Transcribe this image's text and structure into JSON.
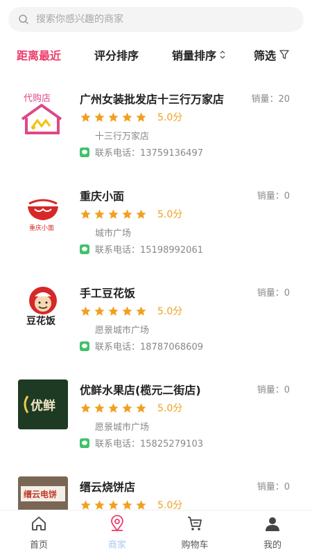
{
  "search": {
    "placeholder": "搜索你感兴趣的商家"
  },
  "sortbar": {
    "distance": "距离最近",
    "rating": "评分排序",
    "sales": "销量排序",
    "filter": "筛选"
  },
  "colors": {
    "accent": "#ee3b6a",
    "star": "#f0a020",
    "wechat": "#41c16b",
    "tab_active": "#a6c8f0"
  },
  "shops": [
    {
      "name": "广州女装批发店十三行万家店",
      "sales": "销量：20",
      "score": "5.0分",
      "stars": 5,
      "address": "十三行万家店",
      "phone": "联系电话：13759136497",
      "logo_icon": "dai-gou-dian-logo",
      "logo_text": "代购店"
    },
    {
      "name": "重庆小面",
      "sales": "销量：0",
      "score": "5.0分",
      "stars": 5,
      "address": "城市广场",
      "phone": "联系电话：15198992061",
      "logo_icon": "noodle-bowl-logo",
      "logo_text": "重庆小面"
    },
    {
      "name": "手工豆花饭",
      "sales": "销量：0",
      "score": "5.0分",
      "stars": 5,
      "address": "愿景城市广场",
      "phone": "联系电话：18787068609",
      "logo_icon": "chef-logo",
      "logo_text": "豆花饭"
    },
    {
      "name": "优鲜水果店(榄元二街店)",
      "sales": "销量：0",
      "score": "5.0分",
      "stars": 5,
      "address": "愿景城市广场",
      "phone": "联系电话：15825279103",
      "logo_icon": "storefront-sign-logo",
      "logo_text": "优鲜"
    },
    {
      "name": "缙云烧饼店",
      "sales": "销量：0",
      "score": "5.0分",
      "stars": 5,
      "address": "",
      "phone": "",
      "logo_icon": "storefront-photo-logo",
      "logo_text": "缙云电饼"
    }
  ],
  "tabbar": {
    "home": "首页",
    "merchants": "商家",
    "cart": "购物车",
    "mine": "我的"
  }
}
